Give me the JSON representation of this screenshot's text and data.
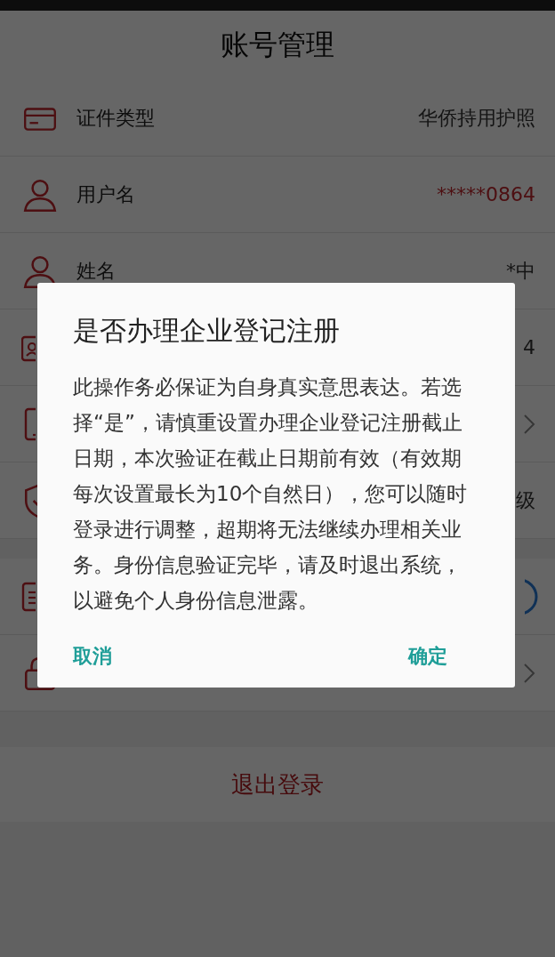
{
  "header": {
    "title": "账号管理"
  },
  "rows": [
    {
      "label": "证件类型",
      "kind": "value",
      "value": "华侨持用护照"
    },
    {
      "label": "用户名",
      "kind": "masked",
      "value": "*****0864"
    },
    {
      "label": "姓名",
      "kind": "value",
      "value": "*中"
    },
    {
      "kind": "value",
      "value": "4"
    },
    {
      "kind": "chevron"
    },
    {
      "kind": "value",
      "value": "级"
    }
  ],
  "rows_2": [
    {
      "kind": "ring"
    },
    {
      "kind": "chevron"
    }
  ],
  "logout_button": "退出登录",
  "dialog": {
    "title": "是否办理企业登记注册",
    "message": "此操作务必保证为自身真实意思表达。若选择“是”，请慎重设置办理企业登记注册截止日期，本次验证在截止日期前有效（有效期每次设置最长为10个自然日），您可以随时登录进行调整，超期将无法继续办理相关业务。身份信息验证完毕，请及时退出系统，以避免个人身份信息泄露。",
    "buttons": [
      "取消",
      "确定"
    ]
  }
}
